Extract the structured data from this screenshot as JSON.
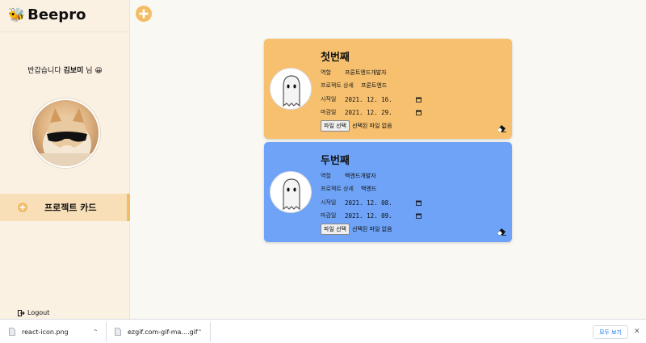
{
  "brand": {
    "icon": "bee-icon",
    "name": "Beepro"
  },
  "sidebar": {
    "welcome_prefix": "반갑습니다",
    "user_name": "김보미",
    "welcome_suffix": "님",
    "welcome_emoji": "😀",
    "nav_item_label": "프로젝트 카드",
    "logout_label": "Logout"
  },
  "colors": {
    "accent": "#f3bd66",
    "card1": "#f6c06f",
    "card2": "#6ea3f7"
  },
  "cards": [
    {
      "title": "첫번째",
      "role_label": "역할",
      "role_value": "프론트엔드개발자",
      "detail_label": "프로젝트 상세",
      "detail_value": "프론트엔드",
      "start_label": "시작일",
      "start_value": "2021. 12. 16.",
      "end_label": "마감일",
      "end_value": "2021. 12. 29.",
      "file_button": "파일 선택",
      "file_status": "선택된 파일 없음"
    },
    {
      "title": "두번째",
      "role_label": "역할",
      "role_value": "백엔드개발자",
      "detail_label": "프로젝트 상세",
      "detail_value": "백엔드",
      "start_label": "시작일",
      "start_value": "2021. 12. 08.",
      "end_label": "마감일",
      "end_value": "2021. 12. 09.",
      "file_button": "파일 선택",
      "file_status": "선택된 파일 없음"
    }
  ],
  "downloads": {
    "items": [
      {
        "name": "react-icon.png"
      },
      {
        "name": "ezgif.com-gif-ma....gif"
      }
    ],
    "show_all": "모두 보기"
  }
}
